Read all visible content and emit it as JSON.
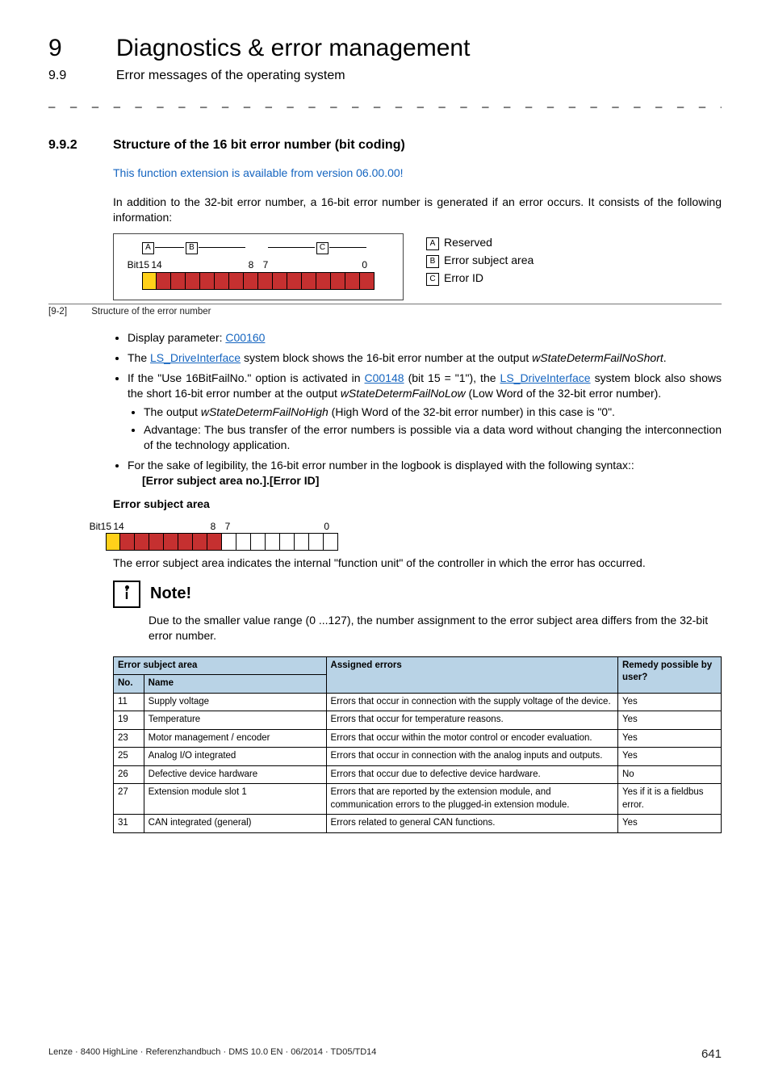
{
  "header": {
    "chapter_num": "9",
    "chapter_title": "Diagnostics & error management",
    "sub_num": "9.9",
    "sub_title": "Error messages of the operating system"
  },
  "dashes": "– – – – – – – – – – – – – – – – – – – – – – – – – – – – – – – – – – – – – – – – – – – – – – – – – – – – – – – – – – – – – – – –",
  "section": {
    "num": "9.9.2",
    "title": "Structure of the 16 bit error number (bit coding)"
  },
  "blue_note": "This function extension is available from version 06.00.00!",
  "intro_para": "In addition to the 32-bit error number, a 16-bit error number is generated if an error occurs. It consists of the following information:",
  "fig": {
    "bit_left": "Bit15",
    "bit_14": "14",
    "bit_8": "8",
    "bit_7": "7",
    "bit_0": "0",
    "A": "A",
    "B": "B",
    "C": "C",
    "legend_A": "Reserved",
    "legend_B": "Error subject area",
    "legend_C": "Error ID",
    "cap_label": "[9-2]",
    "cap_text": "Structure of the error number"
  },
  "bullets": {
    "b1_pre": "Display parameter: ",
    "b1_link": "C00160",
    "b2_pre": "The ",
    "b2_link": "LS_DriveInterface",
    "b2_post_a": " system block shows the 16-bit error number at the output ",
    "b2_ital": "wStateDetermFailNoShort",
    "b2_post_b": ".",
    "b3_a": "If the \"Use 16BitFailNo.\" option is activated in ",
    "b3_link1": "C00148",
    "b3_b": " (bit 15 = \"1\"), the ",
    "b3_link2": "LS_DriveInterface",
    "b3_c": " system block also shows the short 16-bit error number at the output ",
    "b3_ital": "wStateDetermFailNoLow",
    "b3_d": " (Low Word of the 32-bit error number).",
    "b3_s1_a": "The output ",
    "b3_s1_ital": "wStateDetermFailNoHigh",
    "b3_s1_b": " (High Word of the 32-bit error number) in this case is \"0\".",
    "b3_s2": "Advantage: The bus transfer of the error numbers is possible via a data word without changing the interconnection of the technology application.",
    "b4": "For the sake of legibility, the 16-bit error number in the logbook is displayed with the following syntax::",
    "b4_bold": "[Error subject area no.].[Error ID]"
  },
  "subhead_esa": "Error subject area",
  "esa_bits": {
    "left": "Bit15",
    "b14": "14",
    "b8": "8",
    "b7": "7",
    "b0": "0"
  },
  "esa_para": "The error subject area indicates the internal \"function unit\" of the controller in which the error has occurred.",
  "note": {
    "title": "Note!",
    "text": "Due to the smaller value range (0 ...127), the number assignment to the error subject area differs from the 32-bit error number."
  },
  "table": {
    "head_esa": "Error subject area",
    "head_no": "No.",
    "head_name": "Name",
    "head_assigned": "Assigned errors",
    "head_remedy": "Remedy possible by user?",
    "rows": [
      {
        "no": "11",
        "name": "Supply voltage",
        "assigned": "Errors that occur in connection with the supply voltage of the device.",
        "remedy": "Yes"
      },
      {
        "no": "19",
        "name": "Temperature",
        "assigned": "Errors that occur for temperature reasons.",
        "remedy": "Yes"
      },
      {
        "no": "23",
        "name": "Motor management / encoder",
        "assigned": "Errors that occur within the motor control or encoder evaluation.",
        "remedy": "Yes"
      },
      {
        "no": "25",
        "name": "Analog I/O integrated",
        "assigned": "Errors that occur in connection with the analog inputs and outputs.",
        "remedy": "Yes"
      },
      {
        "no": "26",
        "name": "Defective device hardware",
        "assigned": "Errors that occur due to defective device hardware.",
        "remedy": "No"
      },
      {
        "no": "27",
        "name": "Extension module slot 1",
        "assigned": "Errors that are reported by the extension module, and communication errors to the plugged-in extension module.",
        "remedy": "Yes if it is a fieldbus error."
      },
      {
        "no": "31",
        "name": "CAN integrated (general)",
        "assigned": "Errors related to general CAN functions.",
        "remedy": "Yes"
      }
    ]
  },
  "footer": {
    "left": "Lenze · 8400 HighLine · Referenzhandbuch · DMS 10.0 EN · 06/2014 · TD05/TD14",
    "page": "641"
  }
}
